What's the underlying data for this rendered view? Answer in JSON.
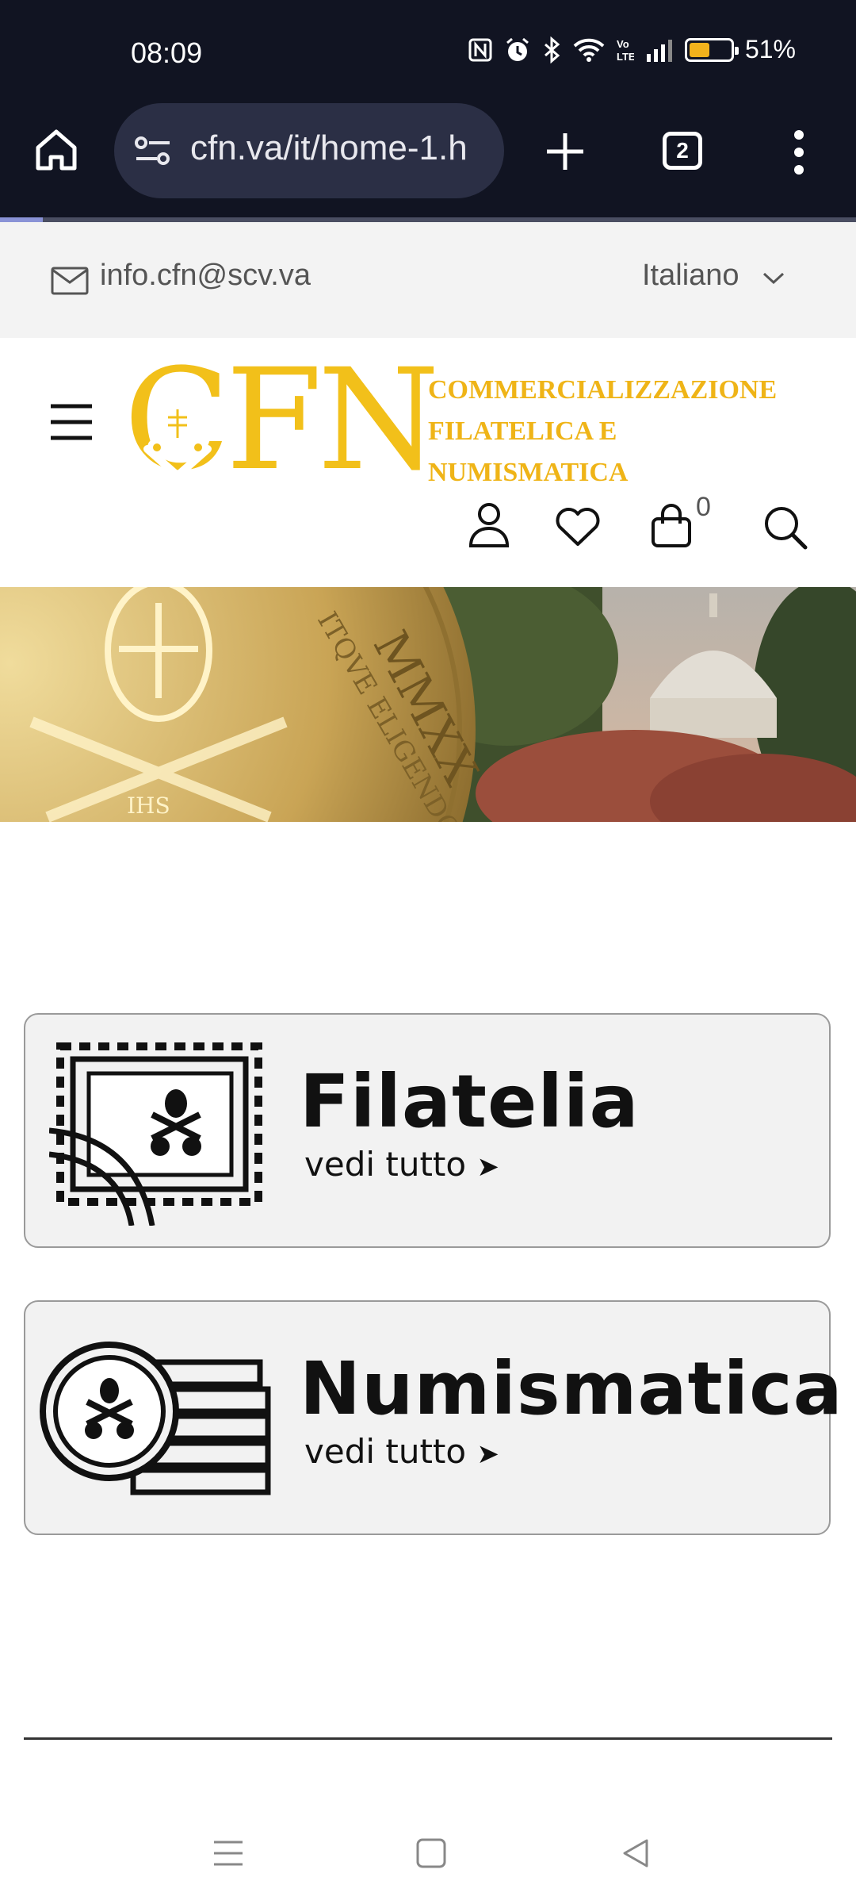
{
  "status": {
    "time": "08:09",
    "battery_pct": "51%",
    "battery_level": 0.51
  },
  "browser": {
    "url": "cfn.va/it/home-1.h",
    "tab_count": "2",
    "load_progress": 0.05
  },
  "topbar": {
    "email": "info.cfn@scv.va",
    "language": "Italiano"
  },
  "logo": {
    "letters": "CFN",
    "line1": "COMMERCIALIZZAZIONE",
    "line2": "FILATELICA E",
    "line3": "NUMISMATICA"
  },
  "header": {
    "cart_count": "0"
  },
  "categories": [
    {
      "title": "Filatelia",
      "link": "vedi tutto",
      "arrow": "➤",
      "icon": "stamp-icon"
    },
    {
      "title": "Numismatica",
      "link": "vedi tutto",
      "arrow": "➤",
      "icon": "coins-icon"
    }
  ],
  "colors": {
    "brand_gold": "#f2c01a",
    "status_bg": "#111422",
    "card_bg": "#f2f2f2"
  }
}
